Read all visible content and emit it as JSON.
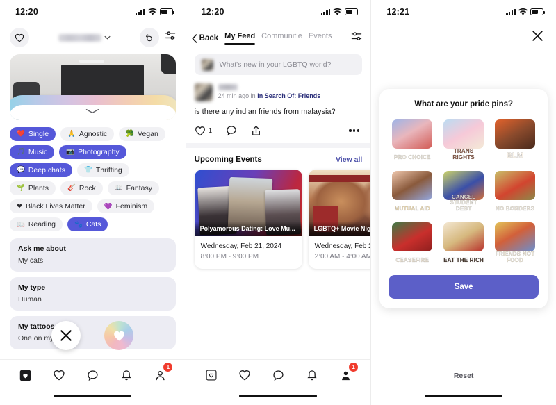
{
  "panel1": {
    "status": {
      "time": "12:20",
      "signal_icon": "signal-bars-icon",
      "wifi_icon": "wifi-icon",
      "battery_icon": "battery-icon"
    },
    "header": {
      "heart_icon": "heart-icon",
      "title_redacted": "",
      "chevron_icon": "chevron-down-icon",
      "rewind_icon": "rewind-icon",
      "filter_icon": "sliders-icon"
    },
    "photo": {
      "expand_icon": "chevron-down-icon"
    },
    "tags": [
      {
        "label": "Single",
        "glyph": "❤️",
        "selected": true
      },
      {
        "label": "Agnostic",
        "glyph": "🙏",
        "selected": false
      },
      {
        "label": "Vegan",
        "glyph": "🥦",
        "selected": false
      },
      {
        "label": "Music",
        "glyph": "🎵",
        "selected": true
      },
      {
        "label": "Photography",
        "glyph": "📷",
        "selected": true
      },
      {
        "label": "Deep chats",
        "glyph": "💬",
        "selected": true
      },
      {
        "label": "Thrifting",
        "glyph": "👕",
        "selected": false
      },
      {
        "label": "Plants",
        "glyph": "🌱",
        "selected": false
      },
      {
        "label": "Rock",
        "glyph": "🎸",
        "selected": false
      },
      {
        "label": "Fantasy",
        "glyph": "📖",
        "selected": false
      },
      {
        "label": "Black Lives Matter",
        "glyph": "❤",
        "selected": false
      },
      {
        "label": "Feminism",
        "glyph": "💜",
        "selected": false
      },
      {
        "label": "Reading",
        "glyph": "📖",
        "selected": false
      },
      {
        "label": "Cats",
        "glyph": "🐾",
        "selected": true
      }
    ],
    "info_cards": [
      {
        "title": "Ask me about",
        "body": "My cats"
      },
      {
        "title": "My type",
        "body": "Human"
      },
      {
        "title": "My tattoos",
        "body": "One on my"
      }
    ],
    "overlay": {
      "close_icon": "close-icon",
      "like_icon": "heart-icon"
    },
    "nav": [
      {
        "name": "cards",
        "icon": "cards-icon",
        "badge": ""
      },
      {
        "name": "likes",
        "icon": "heart-icon",
        "badge": ""
      },
      {
        "name": "chats",
        "icon": "chat-bubble-icon",
        "badge": ""
      },
      {
        "name": "notifications",
        "icon": "bell-icon",
        "badge": ""
      },
      {
        "name": "profile",
        "icon": "person-icon",
        "badge": "1"
      }
    ]
  },
  "panel2": {
    "status": {
      "time": "12:20"
    },
    "back_label": "Back",
    "tabs": [
      {
        "label": "My Feed",
        "active": true
      },
      {
        "label": "Communitie",
        "active": false
      },
      {
        "label": "Events",
        "active": false
      }
    ],
    "filter_icon": "sliders-icon",
    "composer": {
      "placeholder": "What's new in your LGBTQ world?"
    },
    "post": {
      "meta_prefix": "24 min ago in ",
      "meta_community": "In Search Of: Friends",
      "text": "is there any indian friends from malaysia?",
      "like_count": "1",
      "like_icon": "heart-icon",
      "comment_icon": "comment-icon",
      "share_icon": "share-icon",
      "more_icon": "more-dots-icon"
    },
    "events": {
      "title": "Upcoming Events",
      "view_all": "View all",
      "cards": [
        {
          "label": "Polyamorous Dating: Love Mu...",
          "date": "Wednesday, Feb 21, 2024",
          "time": "8:00 PM - 9:00 PM"
        },
        {
          "label": "LGBTQ+ Movie Nig",
          "date": "Wednesday, Feb 2",
          "time": "2:00 AM - 4:00 AM"
        }
      ]
    },
    "nav": [
      {
        "name": "cards",
        "icon": "cards-icon",
        "badge": ""
      },
      {
        "name": "likes",
        "icon": "heart-icon",
        "badge": ""
      },
      {
        "name": "chats",
        "icon": "chat-bubble-icon",
        "badge": ""
      },
      {
        "name": "notifications",
        "icon": "bell-icon",
        "badge": ""
      },
      {
        "name": "profile",
        "icon": "person-icon",
        "badge": "1"
      }
    ]
  },
  "panel3": {
    "status": {
      "time": "12:21"
    },
    "close_icon": "close-icon",
    "question": "What are your pride pins?",
    "pins": [
      {
        "caption": "PRO CHOICE",
        "cap_color": "#f2ece0",
        "bg": "linear-gradient(150deg,#9fb4e6 0%,#e9b6bc 45%,#d25b55 100%)"
      },
      {
        "caption": "TRANS RIGHTS",
        "cap_color": "#fdf6ec",
        "bg": "linear-gradient(150deg,#bcdcf2 0%,#f6c9d8 50%,#f3e9d7 100%)"
      },
      {
        "caption": "BLM",
        "cap_color": "#fbf4ea",
        "bg": "linear-gradient(150deg,#e2622c 0%,#8a4a2c 50%,#4a2a1c 100%)"
      },
      {
        "caption": "MUTUAL AID",
        "cap_color": "#f5e3bd",
        "bg": "linear-gradient(150deg,#f0c8ae 0%,#8a5a3c 50%,#93a8e2 100%)"
      },
      {
        "caption": "CANCEL STUDENT DEBT",
        "cap_color": "#f4f0e6",
        "bg": "linear-gradient(150deg,#cdd46a 0%,#3a4fa8 55%,#d2703c 100%)"
      },
      {
        "caption": "NO BORDERS",
        "cap_color": "#f6efe2",
        "bg": "linear-gradient(150deg,#c9c06a 0%,#d2452f 55%,#8c8a4a 100%)"
      },
      {
        "caption": "CEASEFIRE",
        "cap_color": "#f3eadb",
        "bg": "linear-gradient(150deg,#3f7a46 0%,#c92f2c 55%,#8e1f1e 100%)"
      },
      {
        "caption": "EAT THE RICH",
        "cap_color": "#f4efe4",
        "bg": "linear-gradient(150deg,#f3e7d2 0%,#d6b87e 50%,#b8322c 100%)"
      },
      {
        "caption": "FRIENDS NOT FOOD",
        "cap_color": "#f6efdf",
        "bg": "linear-gradient(150deg,#e2c35a 0%,#d2603a 45%,#6a8fd0 100%)"
      }
    ],
    "save_label": "Save",
    "reset_label": "Reset",
    "accent": "#5c5fc8"
  }
}
